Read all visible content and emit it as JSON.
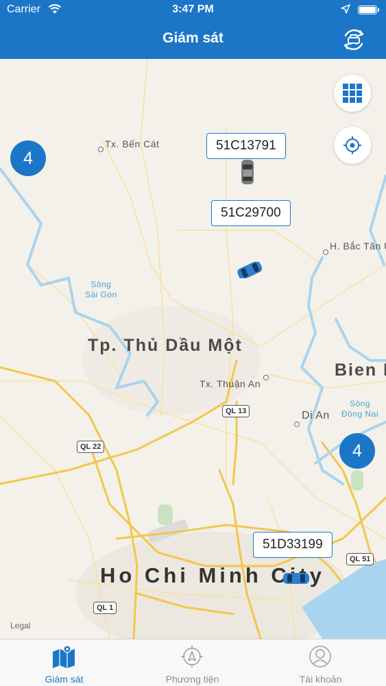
{
  "status_bar": {
    "carrier": "Carrier",
    "time": "3:47 PM"
  },
  "nav": {
    "title": "Giám sát"
  },
  "map": {
    "legal": "Legal",
    "places": {
      "ben_cat": "Tx. Bến Cát",
      "bac_tan_uyen": "H. Bắc Tân U",
      "song_sai_gon_1": "Sông",
      "song_sai_gon_2": "Sài Gòn",
      "thu_dau_mot": "Tp. Thủ Dầu Một",
      "thuan_an": "Tx. Thuận An",
      "bien_hoa": "Bien H",
      "song_dong_nai_1": "Sông",
      "song_dong_nai_2": "Đồng Nai",
      "di_an": "Di An",
      "hcmc": "Ho Chi Minh City"
    },
    "roads": {
      "ql13": "QL 13",
      "ql22": "QL 22",
      "ql51": "QL 51",
      "ql1": "QL 1"
    },
    "vehicles": [
      {
        "plate": "51C13791"
      },
      {
        "plate": "51C29700"
      },
      {
        "plate": "51D33199"
      }
    ],
    "clusters": [
      {
        "count": "4"
      },
      {
        "count": "4"
      }
    ]
  },
  "tabs": [
    {
      "label": "Giám sát",
      "icon": "map-icon",
      "active": true
    },
    {
      "label": "Phương tiện",
      "icon": "compass-icon",
      "active": false
    },
    {
      "label": "Tài khoản",
      "icon": "user-icon",
      "active": false
    }
  ],
  "colors": {
    "primary": "#1b76c8",
    "water": "#a9d4ef",
    "road_major": "#f4c64a",
    "road_minor": "#f7e2a3"
  }
}
